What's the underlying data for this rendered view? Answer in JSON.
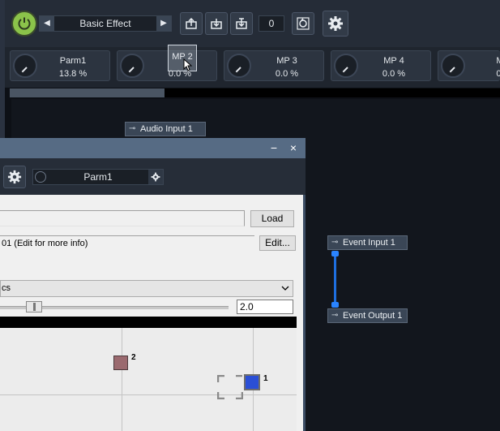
{
  "toolbar": {
    "power_icon": "power-icon",
    "preset_name": "Basic Effect",
    "preset_prev": "◀",
    "preset_next": "▶",
    "counter": "0"
  },
  "knobs": [
    {
      "name": "Parm1",
      "value": "13.8 %"
    },
    {
      "name": "",
      "value": "0.0 %"
    },
    {
      "name": "MP 3",
      "value": "0.0 %"
    },
    {
      "name": "MP 4",
      "value": "0.0 %"
    },
    {
      "name": "M",
      "value": "0."
    }
  ],
  "progress": {
    "fraction": 0.315
  },
  "tooltip": {
    "text": "MP 2"
  },
  "nodes": {
    "audio_input": "Audio Input 1",
    "event_input": "Event Input 1",
    "event_output": "Event Output 1"
  },
  "dialog": {
    "minimize": "−",
    "close": "×",
    "param_name": "Parm1",
    "load_label": "Load",
    "info_text": "01 (Edit for more info)",
    "edit_label": "Edit...",
    "dropdown_value": "cs",
    "slider_value": "2.0",
    "slider_fraction": 0.14,
    "point_labels": [
      "2",
      "1"
    ]
  },
  "colors": {
    "accent_power": "#8bc34a",
    "point1": "#2a4fd6",
    "point2": "#9b6a6f",
    "connector": "#1e6fe0"
  }
}
